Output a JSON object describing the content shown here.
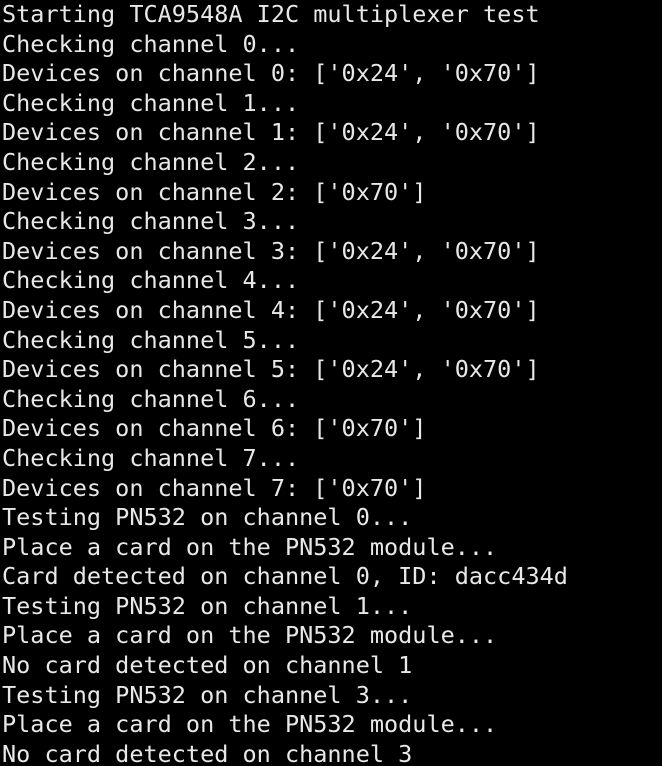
{
  "terminal": {
    "background": "#000000",
    "foreground": "#e8e8e8",
    "lines": [
      "Starting TCA9548A I2C multiplexer test",
      "Checking channel 0...",
      "Devices on channel 0: ['0x24', '0x70']",
      "Checking channel 1...",
      "Devices on channel 1: ['0x24', '0x70']",
      "Checking channel 2...",
      "Devices on channel 2: ['0x70']",
      "Checking channel 3...",
      "Devices on channel 3: ['0x24', '0x70']",
      "Checking channel 4...",
      "Devices on channel 4: ['0x24', '0x70']",
      "Checking channel 5...",
      "Devices on channel 5: ['0x24', '0x70']",
      "Checking channel 6...",
      "Devices on channel 6: ['0x70']",
      "Checking channel 7...",
      "Devices on channel 7: ['0x70']",
      "Testing PN532 on channel 0...",
      "Place a card on the PN532 module...",
      "Card detected on channel 0, ID: dacc434d",
      "Testing PN532 on channel 1...",
      "Place a card on the PN532 module...",
      "No card detected on channel 1",
      "Testing PN532 on channel 3...",
      "Place a card on the PN532 module...",
      "No card detected on channel 3"
    ]
  }
}
